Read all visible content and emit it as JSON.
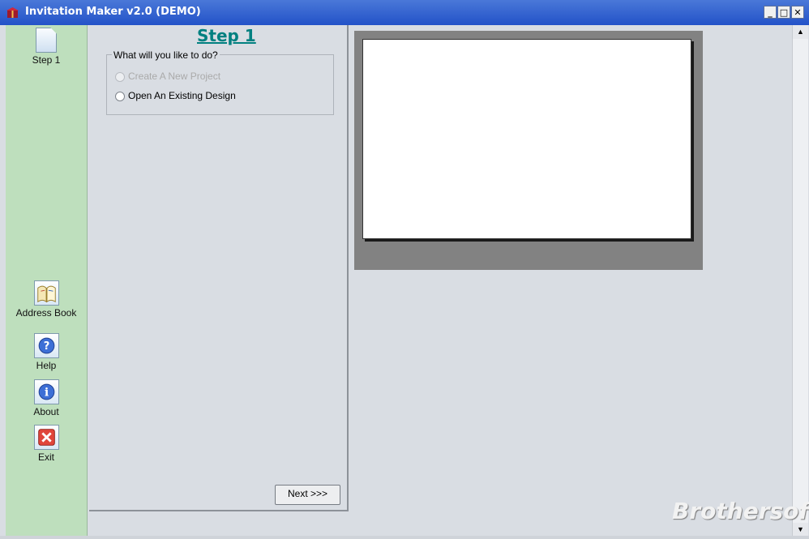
{
  "window": {
    "title": "Invitation Maker v2.0 (DEMO)",
    "buttons": {
      "minimize": "_",
      "maximize": "□",
      "close": "✕"
    }
  },
  "sidebar": {
    "items": [
      {
        "label": "Step 1",
        "icon": "document-icon"
      },
      {
        "label": "Address Book",
        "icon": "address-book-icon"
      },
      {
        "label": "Help",
        "icon": "help-icon"
      },
      {
        "label": "About",
        "icon": "about-icon"
      },
      {
        "label": "Exit",
        "icon": "exit-icon"
      }
    ]
  },
  "wizard": {
    "step_title": "Step 1",
    "question": "What will you like to do?",
    "options": [
      {
        "label": "Create A New Project",
        "enabled": false,
        "selected": false
      },
      {
        "label": "Open An Existing Design",
        "enabled": true,
        "selected": false
      }
    ],
    "next_label": "Next >>>"
  },
  "preview": {
    "frame_color": "#828282",
    "canvas_color": "#ffffff"
  },
  "watermark": "Brothersoft",
  "colors": {
    "titlebar": "#2352c8",
    "sidebar_background": "#bedfbd",
    "panel_background": "#d9dde3",
    "step_title_color": "#008080"
  }
}
